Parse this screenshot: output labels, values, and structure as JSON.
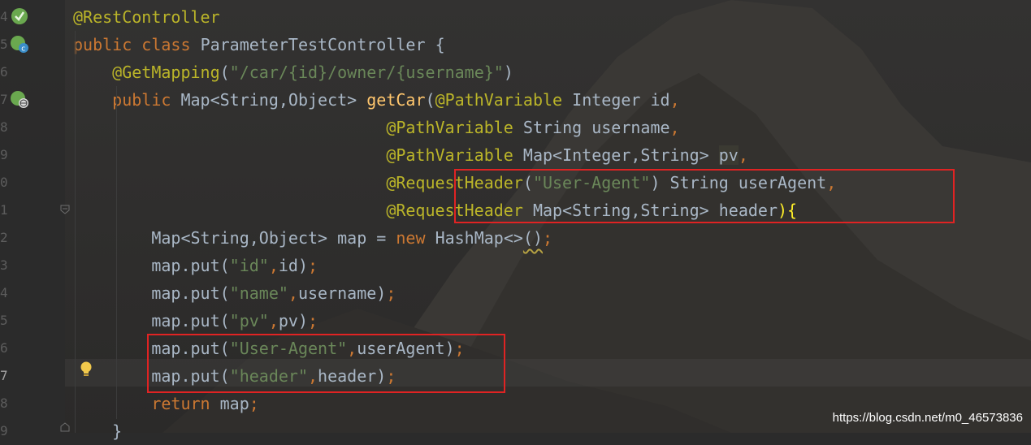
{
  "gutter": {
    "line_numbers": [
      "4",
      "5",
      "6",
      "7",
      "8",
      "9",
      "0",
      "1",
      "2",
      "3",
      "4",
      "5",
      "6",
      "7",
      "8",
      "9"
    ],
    "active_line_index": 13
  },
  "code": {
    "l1": {
      "annotation": "@RestController"
    },
    "l2": {
      "kw1": "public",
      "kw2": "class",
      "name": "ParameterTestController",
      "brace": "{"
    },
    "l3": {
      "annotation": "@GetMapping",
      "open": "(",
      "value": "\"/car/{id}/owner/{username}\"",
      "close": ")"
    },
    "l4": {
      "kw": "public",
      "type": "Map<String,Object>",
      "method": "getCar",
      "open": "(",
      "annotation": "@PathVariable",
      "ptype": "Integer",
      "pname": "id",
      "comma": ","
    },
    "l5": {
      "annotation": "@PathVariable",
      "ptype": "String",
      "pname": "username",
      "comma": ","
    },
    "l6": {
      "annotation": "@PathVariable",
      "ptype": "Map<Integer,String>",
      "pname": "pv",
      "comma": ","
    },
    "l7": {
      "annotation": "@RequestHeader",
      "open": "(",
      "value": "\"User-Agent\"",
      "close": ")",
      "ptype": "String",
      "pname": "userAgent",
      "comma": ","
    },
    "l8": {
      "annotation": "@RequestHeader",
      "ptype": "Map<String,String>",
      "pname": "header",
      "close": ")",
      "brace": "{"
    },
    "l9": {
      "type": "Map<String,Object>",
      "var": "map",
      "eq": "=",
      "kw": "new",
      "ctor": "HashMap<>",
      "parens": "()",
      "semi": ";"
    },
    "l10": {
      "call": "map.put",
      "open": "(",
      "key": "\"id\"",
      "comma": ",",
      "arg": "id",
      "close": ")",
      "semi": ";"
    },
    "l11": {
      "call": "map.put",
      "open": "(",
      "key": "\"name\"",
      "comma": ",",
      "arg": "username",
      "close": ")",
      "semi": ";"
    },
    "l12": {
      "call": "map.put",
      "open": "(",
      "key": "\"pv\"",
      "comma": ",",
      "arg": "pv",
      "close": ")",
      "semi": ";"
    },
    "l13": {
      "call": "map.put",
      "open": "(",
      "key": "\"User-Agent\"",
      "comma": ",",
      "arg": "userAgent",
      "close": ")",
      "semi": ";"
    },
    "l14": {
      "call": "map.put",
      "open": "(",
      "key": "\"header\"",
      "comma": ",",
      "arg": "header",
      "close": ")",
      "semi": ";"
    },
    "l15": {
      "kw": "return",
      "arg": "map",
      "semi": ";"
    },
    "l16": {
      "brace": "}"
    }
  },
  "watermark": "https://blog.csdn.net/m0_46573836",
  "colors": {
    "background": "#2b2b2b",
    "keyword": "#cc7832",
    "annotation": "#bbb529",
    "string": "#6a8759",
    "method": "#ffc66d",
    "identifier": "#a9b7c6",
    "highlight_box": "#e02323"
  },
  "icons": [
    "spring-bean-icon",
    "spring-controller-icon",
    "web-endpoint-icon",
    "fold-marker-icon",
    "lightbulb-icon"
  ]
}
